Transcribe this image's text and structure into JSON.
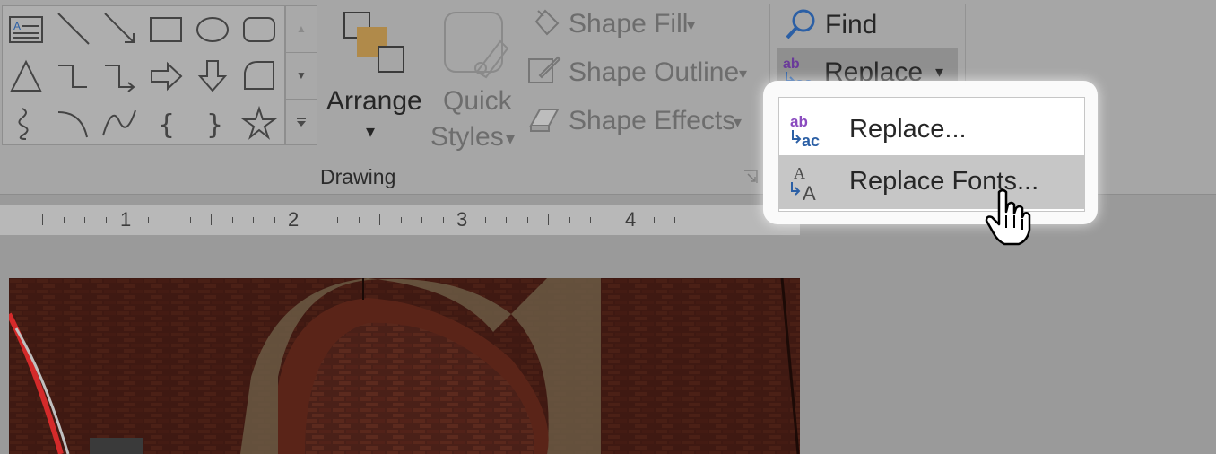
{
  "ribbon": {
    "shapes_gallery": {
      "shapes": [
        "text-box",
        "line",
        "arrow-line",
        "rectangle",
        "oval",
        "rounded-rectangle",
        "triangle",
        "elbow-connector",
        "elbow-arrow-connector",
        "right-arrow",
        "down-arrow",
        "flowchart-card",
        "freeform-scribble",
        "arc",
        "curve",
        "left-brace",
        "right-brace",
        "star"
      ],
      "scroll_up": "▲",
      "scroll_down": "▼",
      "more": "⯆"
    },
    "arrange": {
      "label": "Arrange",
      "dropdown": "▾"
    },
    "quick_styles": {
      "line1": "Quick",
      "line2": "Styles",
      "dropdown": "▾"
    },
    "shape_fill": {
      "label": "Shape Fill",
      "dropdown": "▾"
    },
    "shape_outline": {
      "label": "Shape Outline",
      "dropdown": "▾"
    },
    "shape_effects": {
      "label": "Shape Effects",
      "dropdown": "▾"
    },
    "drawing_group_label": "Drawing",
    "find": {
      "label": "Find"
    },
    "replace": {
      "label": "Replace",
      "dropdown": "▾"
    }
  },
  "ruler": {
    "numbers": [
      "1",
      "2",
      "3",
      "4"
    ]
  },
  "replace_menu": {
    "items": [
      {
        "label": "Replace...",
        "icon": "replace-icon"
      },
      {
        "label": "Replace Fonts...",
        "icon": "replace-fonts-icon",
        "hovered": true
      }
    ]
  },
  "colors": {
    "accent_blue": "#2b5fa5",
    "accent_purple": "#8a4bbf",
    "menu_hover": "#c6c6c6"
  }
}
